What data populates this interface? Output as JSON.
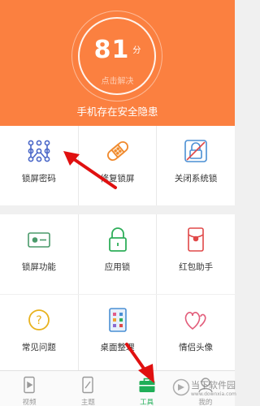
{
  "header": {
    "score": "81",
    "score_unit": "分",
    "hint": "点击解决",
    "status": "手机存在安全隐患"
  },
  "tools": [
    {
      "label": "锁屏密码",
      "icon": "pattern-lock-icon"
    },
    {
      "label": "修复锁屏",
      "icon": "bandage-icon"
    },
    {
      "label": "关闭系统锁",
      "icon": "disable-lock-icon"
    },
    {
      "label": "锁屏功能",
      "icon": "lock-function-icon"
    },
    {
      "label": "应用锁",
      "icon": "app-lock-icon"
    },
    {
      "label": "红包助手",
      "icon": "red-packet-icon"
    },
    {
      "label": "常见问题",
      "icon": "question-icon"
    },
    {
      "label": "桌面整理",
      "icon": "desktop-organize-icon"
    },
    {
      "label": "情侣头像",
      "icon": "couple-avatar-icon"
    }
  ],
  "tabs": [
    {
      "label": "视频",
      "icon": "video-icon",
      "active": false
    },
    {
      "label": "主题",
      "icon": "theme-icon",
      "active": false
    },
    {
      "label": "工具",
      "icon": "toolbox-icon",
      "active": true
    },
    {
      "label": "我的",
      "icon": "profile-icon",
      "active": false
    }
  ],
  "watermark": {
    "text": "当下软件园",
    "url_text": "www.downxia.com"
  },
  "colors": {
    "header": "#fb8040",
    "active_tab": "#1fae57",
    "arrow": "#e01010"
  }
}
